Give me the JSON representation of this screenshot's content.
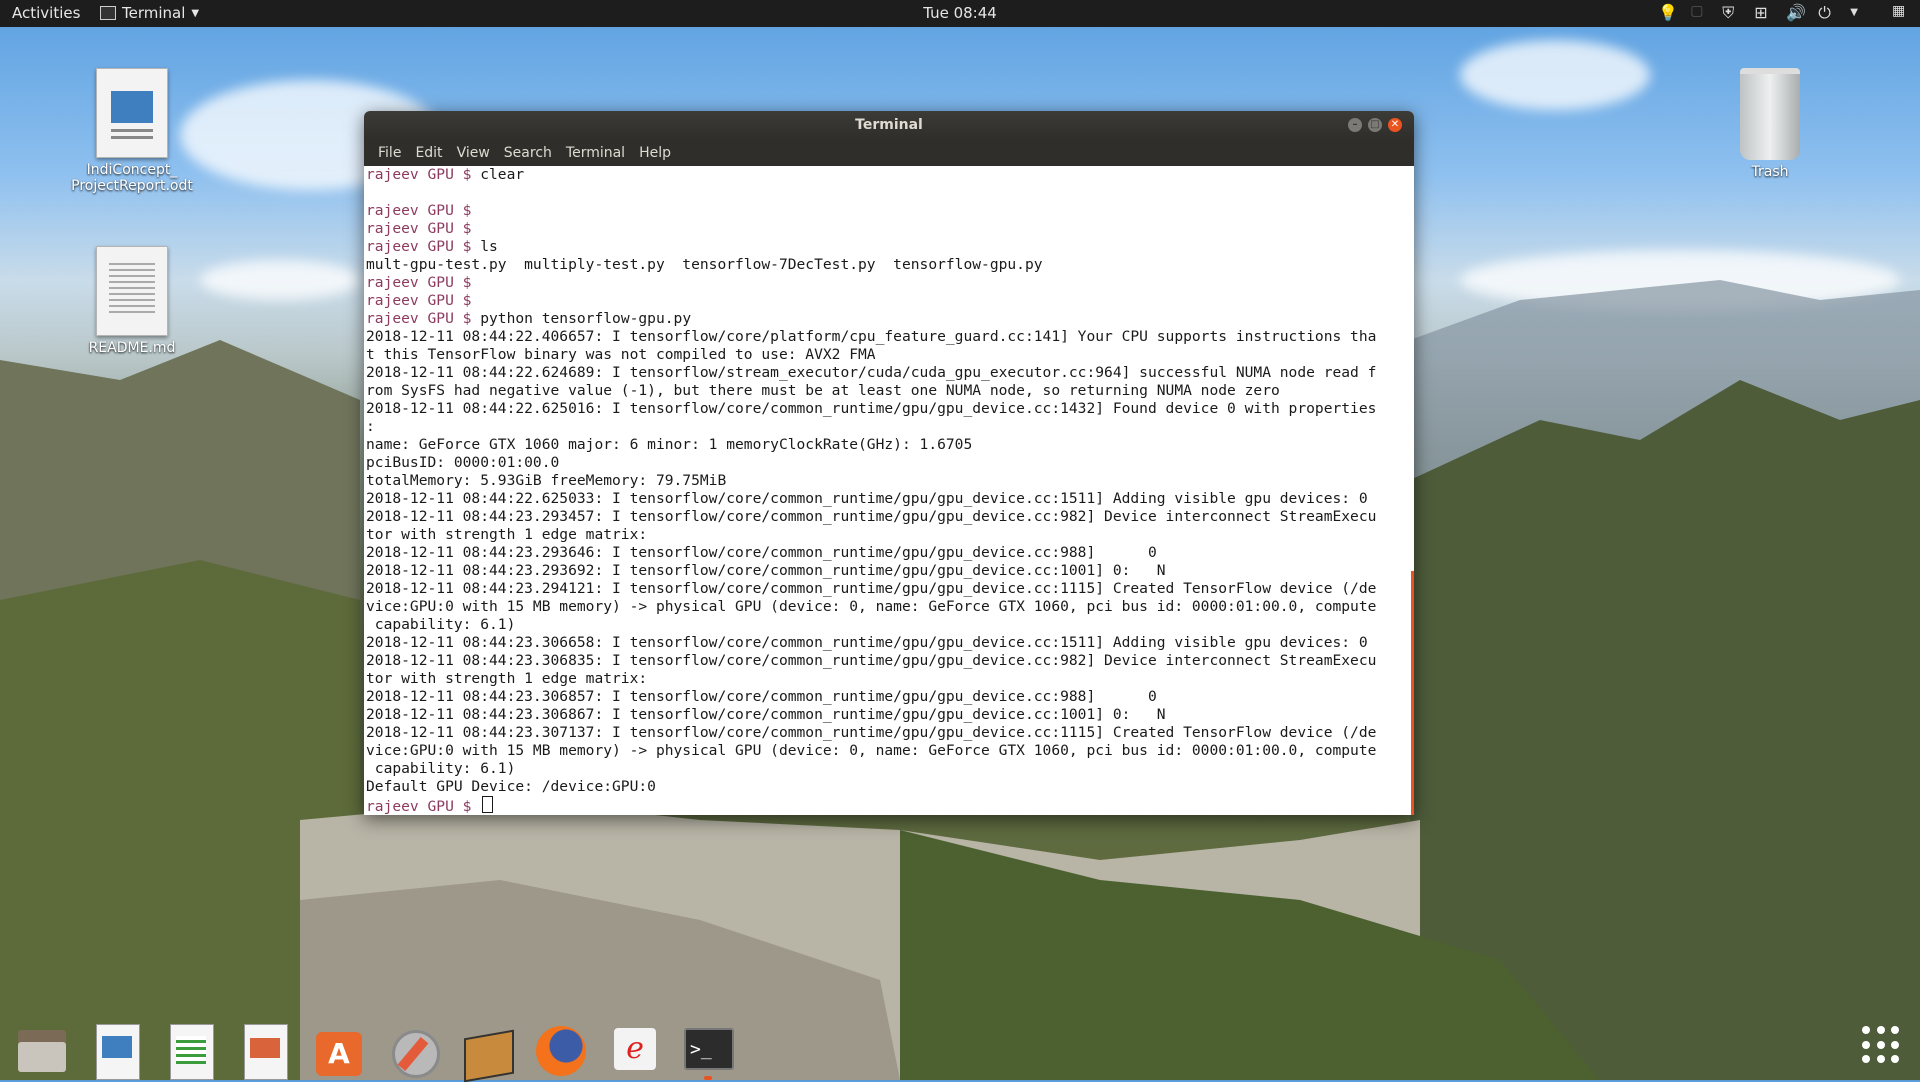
{
  "topbar": {
    "activities": "Activities",
    "app_menu": "Terminal",
    "clock": "Tue 08:44"
  },
  "desktop": {
    "icons": [
      {
        "label": "IndiConcept_\nProjectReport.odt"
      },
      {
        "label": "README.md"
      },
      {
        "label": "Trash"
      }
    ]
  },
  "terminal": {
    "title": "Terminal",
    "menu": [
      "File",
      "Edit",
      "View",
      "Search",
      "Terminal",
      "Help"
    ],
    "lines": [
      {
        "prompt": "rajeev GPU $ ",
        "text": "clear"
      },
      {
        "prompt": "",
        "text": ""
      },
      {
        "prompt": "rajeev GPU $ ",
        "text": ""
      },
      {
        "prompt": "rajeev GPU $ ",
        "text": ""
      },
      {
        "prompt": "rajeev GPU $ ",
        "text": "ls"
      },
      {
        "prompt": "",
        "text": "mult-gpu-test.py  multiply-test.py  tensorflow-7DecTest.py  tensorflow-gpu.py"
      },
      {
        "prompt": "rajeev GPU $ ",
        "text": ""
      },
      {
        "prompt": "rajeev GPU $ ",
        "text": ""
      },
      {
        "prompt": "rajeev GPU $ ",
        "text": "python tensorflow-gpu.py"
      },
      {
        "prompt": "",
        "text": "2018-12-11 08:44:22.406657: I tensorflow/core/platform/cpu_feature_guard.cc:141] Your CPU supports instructions tha"
      },
      {
        "prompt": "",
        "text": "t this TensorFlow binary was not compiled to use: AVX2 FMA"
      },
      {
        "prompt": "",
        "text": "2018-12-11 08:44:22.624689: I tensorflow/stream_executor/cuda/cuda_gpu_executor.cc:964] successful NUMA node read f"
      },
      {
        "prompt": "",
        "text": "rom SysFS had negative value (-1), but there must be at least one NUMA node, so returning NUMA node zero"
      },
      {
        "prompt": "",
        "text": "2018-12-11 08:44:22.625016: I tensorflow/core/common_runtime/gpu/gpu_device.cc:1432] Found device 0 with properties"
      },
      {
        "prompt": "",
        "text": ":"
      },
      {
        "prompt": "",
        "text": "name: GeForce GTX 1060 major: 6 minor: 1 memoryClockRate(GHz): 1.6705"
      },
      {
        "prompt": "",
        "text": "pciBusID: 0000:01:00.0"
      },
      {
        "prompt": "",
        "text": "totalMemory: 5.93GiB freeMemory: 79.75MiB"
      },
      {
        "prompt": "",
        "text": "2018-12-11 08:44:22.625033: I tensorflow/core/common_runtime/gpu/gpu_device.cc:1511] Adding visible gpu devices: 0"
      },
      {
        "prompt": "",
        "text": "2018-12-11 08:44:23.293457: I tensorflow/core/common_runtime/gpu/gpu_device.cc:982] Device interconnect StreamExecu"
      },
      {
        "prompt": "",
        "text": "tor with strength 1 edge matrix:"
      },
      {
        "prompt": "",
        "text": "2018-12-11 08:44:23.293646: I tensorflow/core/common_runtime/gpu/gpu_device.cc:988]      0"
      },
      {
        "prompt": "",
        "text": "2018-12-11 08:44:23.293692: I tensorflow/core/common_runtime/gpu/gpu_device.cc:1001] 0:   N"
      },
      {
        "prompt": "",
        "text": "2018-12-11 08:44:23.294121: I tensorflow/core/common_runtime/gpu/gpu_device.cc:1115] Created TensorFlow device (/de"
      },
      {
        "prompt": "",
        "text": "vice:GPU:0 with 15 MB memory) -> physical GPU (device: 0, name: GeForce GTX 1060, pci bus id: 0000:01:00.0, compute"
      },
      {
        "prompt": "",
        "text": " capability: 6.1)"
      },
      {
        "prompt": "",
        "text": "2018-12-11 08:44:23.306658: I tensorflow/core/common_runtime/gpu/gpu_device.cc:1511] Adding visible gpu devices: 0"
      },
      {
        "prompt": "",
        "text": "2018-12-11 08:44:23.306835: I tensorflow/core/common_runtime/gpu/gpu_device.cc:982] Device interconnect StreamExecu"
      },
      {
        "prompt": "",
        "text": "tor with strength 1 edge matrix:"
      },
      {
        "prompt": "",
        "text": "2018-12-11 08:44:23.306857: I tensorflow/core/common_runtime/gpu/gpu_device.cc:988]      0"
      },
      {
        "prompt": "",
        "text": "2018-12-11 08:44:23.306867: I tensorflow/core/common_runtime/gpu/gpu_device.cc:1001] 0:   N"
      },
      {
        "prompt": "",
        "text": "2018-12-11 08:44:23.307137: I tensorflow/core/common_runtime/gpu/gpu_device.cc:1115] Created TensorFlow device (/de"
      },
      {
        "prompt": "",
        "text": "vice:GPU:0 with 15 MB memory) -> physical GPU (device: 0, name: GeForce GTX 1060, pci bus id: 0000:01:00.0, compute"
      },
      {
        "prompt": "",
        "text": " capability: 6.1)"
      },
      {
        "prompt": "",
        "text": "Default GPU Device: /device:GPU:0"
      },
      {
        "prompt": "rajeev GPU $ ",
        "text": "",
        "cursor": true
      }
    ]
  },
  "dock": {
    "items": [
      {
        "icon": "files-icon"
      },
      {
        "icon": "writer-icon"
      },
      {
        "icon": "calc-icon"
      },
      {
        "icon": "impress-icon"
      },
      {
        "icon": "software-icon"
      },
      {
        "icon": "settings-icon"
      },
      {
        "icon": "package-icon"
      },
      {
        "icon": "firefox-icon"
      },
      {
        "icon": "pdf-reader-icon"
      },
      {
        "icon": "terminal-icon"
      }
    ]
  },
  "colors": {
    "accent": "#e95420",
    "prompt_user": "#8e3a5f",
    "prompt_gpu": "#3465a4"
  }
}
